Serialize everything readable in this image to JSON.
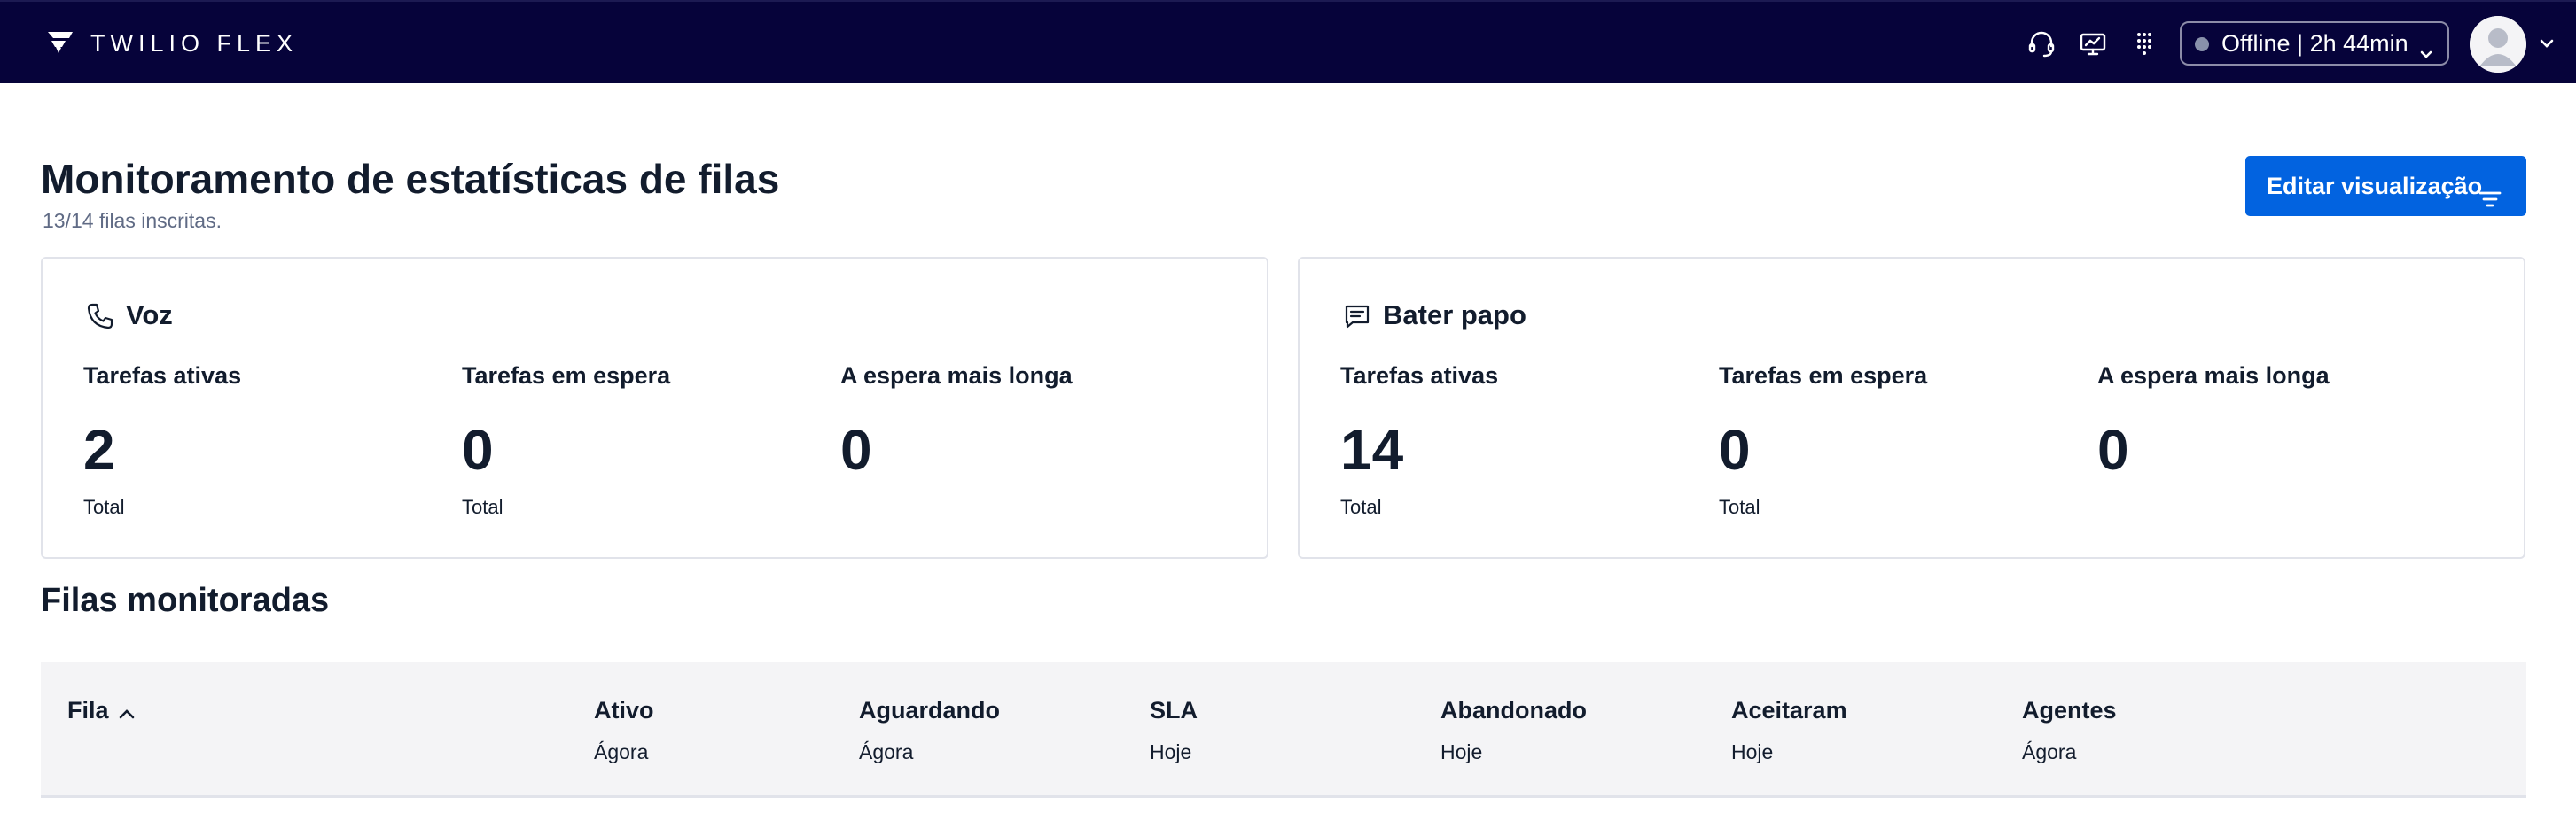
{
  "topbar": {
    "brand": "TWILIO FLEX",
    "icons": [
      "headset-icon",
      "screen-icon",
      "dialpad-icon"
    ],
    "status": {
      "label": "Offline | 2h 44min",
      "dot_color": "#8891aa"
    },
    "avatar": "avatar"
  },
  "header": {
    "title": "Monitoramento de estatísticas de filas",
    "subtitle": "13/14 filas inscritas.",
    "edit_button": "Editar visualização"
  },
  "cards": [
    {
      "title": "Voz",
      "icon": "phone-icon",
      "metrics": [
        {
          "label": "Tarefas ativas",
          "value": "2",
          "sub": "Total"
        },
        {
          "label": "Tarefas em espera",
          "value": "0",
          "sub": "Total"
        },
        {
          "label": "A espera mais longa",
          "value": "0",
          "sub": ""
        }
      ]
    },
    {
      "title": "Bater papo",
      "icon": "chat-icon",
      "metrics": [
        {
          "label": "Tarefas ativas",
          "value": "14",
          "sub": "Total"
        },
        {
          "label": "Tarefas em espera",
          "value": "0",
          "sub": "Total"
        },
        {
          "label": "A espera mais longa",
          "value": "0",
          "sub": ""
        }
      ]
    }
  ],
  "table": {
    "title": "Filas monitoradas",
    "columns": [
      {
        "label": "Fila",
        "sub": ""
      },
      {
        "label": "Ativo",
        "sub": "Ágora"
      },
      {
        "label": "Aguardando",
        "sub": "Ágora"
      },
      {
        "label": "SLA",
        "sub": "Hoje"
      },
      {
        "label": "Abandonado",
        "sub": "Hoje"
      },
      {
        "label": "Aceitaram",
        "sub": "Hoje"
      },
      {
        "label": "Agentes",
        "sub": "Ágora"
      }
    ]
  },
  "colors": {
    "topbar_bg": "#06033a",
    "primary": "#0263e0",
    "text": "#121c2d",
    "muted": "#606b85"
  }
}
